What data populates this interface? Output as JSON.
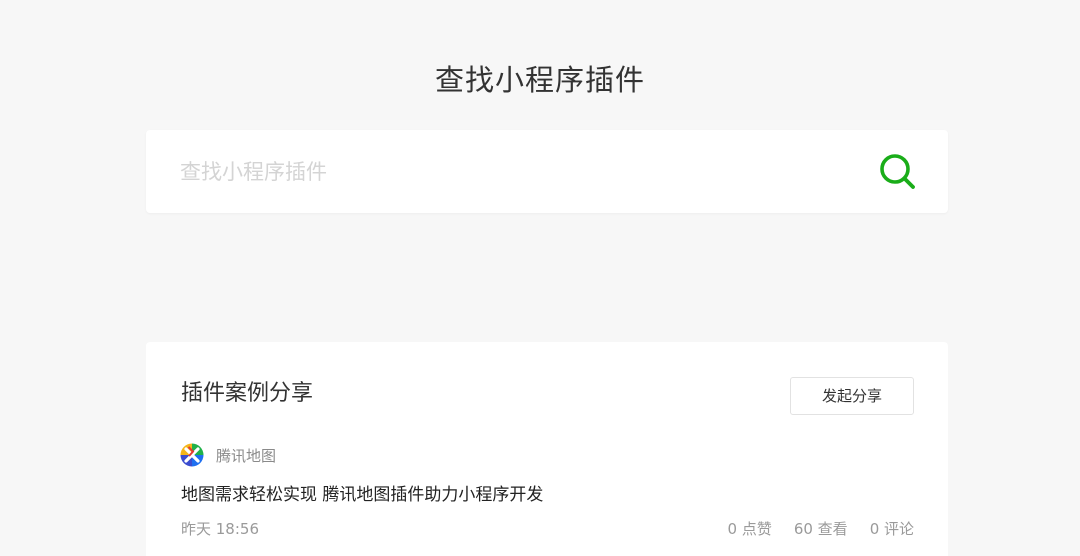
{
  "page": {
    "title": "查找小程序插件"
  },
  "search": {
    "placeholder": "查找小程序插件",
    "value": "",
    "icon": "search-icon",
    "accent_color": "#1aad19"
  },
  "case_share": {
    "title": "插件案例分享",
    "share_button_label": "发起分享",
    "posts": [
      {
        "author": "腾讯地图",
        "author_icon": "tencent-map-logo-icon",
        "title": "地图需求轻松实现 腾讯地图插件助力小程序开发",
        "time": "昨天 18:56",
        "likes": "0 点赞",
        "views": "60 查看",
        "comments": "0 评论"
      }
    ]
  }
}
